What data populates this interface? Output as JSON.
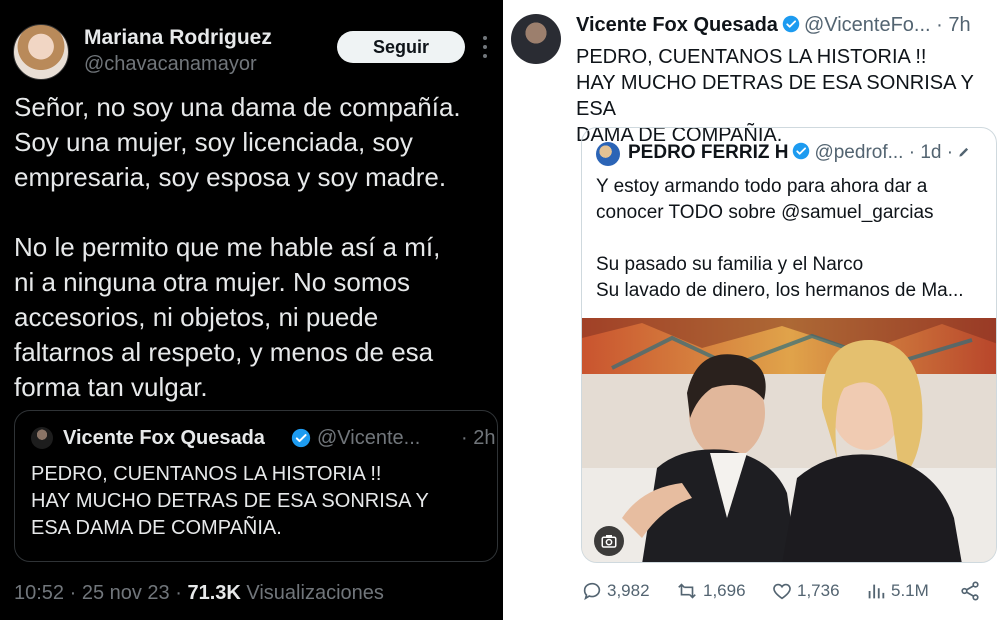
{
  "left_tweet": {
    "author_name": "Mariana Rodriguez",
    "author_handle": "@chavacanamayor",
    "follow_label": "Seguir",
    "text": "Señor, no soy una dama de compañía.\nSoy una mujer, soy licenciada, soy\nempresaria, soy esposa y soy madre.\n\nNo le permito que me hable así a mí,\nni a ninguna otra mujer. No somos\naccesorios, ni objetos, ni puede\nfaltarnos al respeto, y menos de esa\nforma tan vulgar.",
    "quote": {
      "author_name": "Vicente Fox Quesada",
      "author_handle": "@Vicente...",
      "time": "· 2h",
      "text": "PEDRO, CUENTANOS LA HISTORIA !!\nHAY MUCHO DETRAS DE ESA SONRISA Y\nESA DAMA DE COMPAÑIA."
    },
    "timestamp": "10:52 · 25 nov 23 · ",
    "views_count": "71.3K",
    "views_label": " Visualizaciones"
  },
  "right_tweet": {
    "author_name": "Vicente Fox Quesada",
    "author_handle": "@VicenteFo...",
    "time": "· 7h",
    "text": "PEDRO, CUENTANOS LA HISTORIA !!\nHAY MUCHO DETRAS DE ESA SONRISA Y ESA\nDAMA DE COMPAÑIA.",
    "quote": {
      "author_name": "PEDRO FERRIZ H",
      "author_handle": "@pedrof...",
      "time": "· 1d ·",
      "text": "Y estoy armando todo para ahora dar a\nconocer TODO sobre @samuel_garcias\n\nSu pasado su familia y  el Narco\nSu lavado de dinero, los hermanos de Ma..."
    },
    "actions": {
      "replies": "3,982",
      "reposts": "1,696",
      "likes": "1,736",
      "views": "5.1M"
    }
  },
  "colors": {
    "verified_blue": "#1d9bf0",
    "dark_bg": "#000000",
    "light_bg": "#ffffff",
    "muted_dark": "#71767b",
    "muted_light": "#536471"
  }
}
